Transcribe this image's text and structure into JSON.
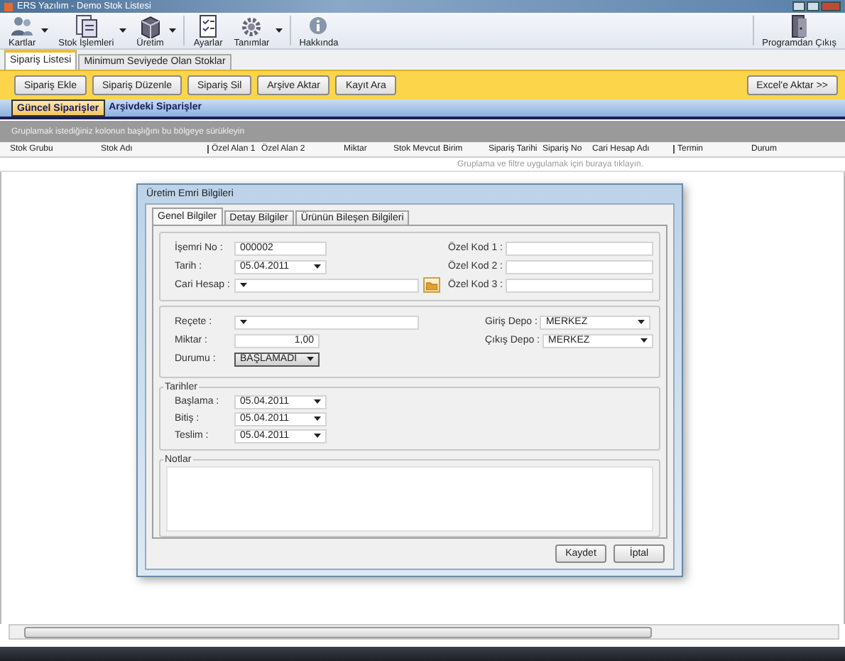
{
  "window": {
    "title": "ERS Yazılım - Demo Stok Listesi"
  },
  "toolbar": {
    "items": [
      {
        "label": "Kartlar",
        "dropdown": true
      },
      {
        "label": "Stok İşlemleri",
        "dropdown": true
      },
      {
        "label": "Üretim",
        "dropdown": true
      },
      {
        "label": "Ayarlar",
        "dropdown": false
      },
      {
        "label": "Tanımlar",
        "dropdown": true
      },
      {
        "label": "Hakkında",
        "dropdown": false
      }
    ],
    "exit": {
      "label": "Programdan Çıkış"
    }
  },
  "tabs": [
    {
      "label": "Sipariş Listesi",
      "selected": true
    },
    {
      "label": "Minimum Seviyede Olan Stoklar",
      "selected": false
    }
  ],
  "actions": [
    "Sipariş Ekle",
    "Sipariş Düzenle",
    "Sipariş Sil",
    "Arşive Aktar",
    "Kayıt Ara"
  ],
  "export_button": "Excel'e Aktar >>",
  "sub_tabs": [
    {
      "label": "Güncel Siparişler",
      "selected": true
    },
    {
      "label": "Arşivdeki Siparişler",
      "selected": false
    }
  ],
  "group_hint": "Gruplamak istediğiniz kolonun başlığını bu bölgeye sürükleyin",
  "table": {
    "columns": [
      "Stok Grubu",
      "Stok Adı",
      "Özel Alan 1",
      "Özel Alan 2",
      "Miktar",
      "Stok Mevcut",
      "Birim",
      "Sipariş Tarihi",
      "Sipariş No",
      "Cari Hesap Adı",
      "Termin",
      "Durum"
    ],
    "filter_hint": "Gruplama ve filtre uygulamak için buraya tıklayın."
  },
  "dialog": {
    "title": "Üretim Emri Bilgileri",
    "tabs": [
      {
        "label": "Genel Bilgiler",
        "selected": true
      },
      {
        "label": "Detay Bilgiler",
        "selected": false
      },
      {
        "label": "Ürünün Bileşen Bilgileri",
        "selected": false
      }
    ],
    "header_fields": [
      {
        "label": "İşemri No :",
        "value": "000002",
        "kind": "text"
      },
      {
        "label": "Tarih :",
        "value": "05.04.2011",
        "kind": "date"
      },
      {
        "label": "Cari Hesap :",
        "kind": "lookup"
      }
    ],
    "special_codes": [
      {
        "label": "Özel Kod 1 :"
      },
      {
        "label": "Özel Kod 2 :"
      },
      {
        "label": "Özel Kod 3 :"
      }
    ],
    "recipe_fields": [
      {
        "label": "Reçete :",
        "kind": "combo"
      },
      {
        "label": "Miktar :",
        "value": "1,00",
        "kind": "number"
      },
      {
        "label": "Durumu :",
        "value": "BAŞLAMADI",
        "kind": "status"
      }
    ],
    "depots": [
      {
        "label": "Giriş Depo :",
        "value": "MERKEZ"
      },
      {
        "label": "Çıkış Depo :",
        "value": "MERKEZ"
      }
    ],
    "dates": {
      "title": "Tarihler",
      "fields": [
        {
          "label": "Başlama :",
          "value": "05.04.2011",
          "kind": "date"
        },
        {
          "label": "Bitiş :",
          "value": "05.04.2011",
          "kind": "date"
        },
        {
          "label": "Teslim :",
          "value": "05.04.2011",
          "kind": "date"
        }
      ]
    },
    "notes": {
      "title": "Notlar"
    },
    "buttons": [
      "Kaydet",
      "İptal"
    ]
  }
}
